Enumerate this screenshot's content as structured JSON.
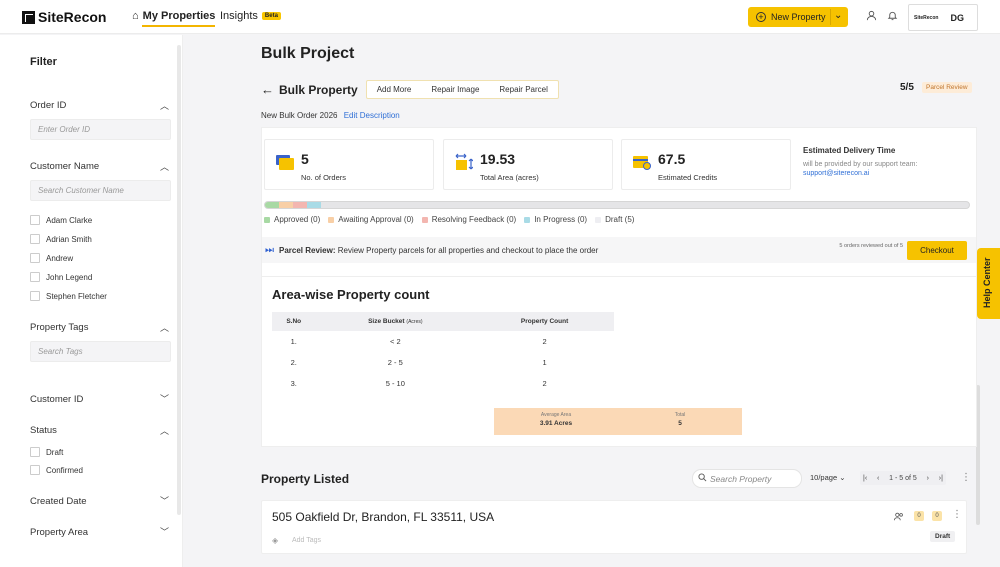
{
  "app": {
    "name": "SiteRecon"
  },
  "nav": {
    "home": "My Properties",
    "insights": "Insights",
    "beta": "Beta",
    "new_property": "New Property",
    "profile_logo": "SiteRecon",
    "initials": "DG"
  },
  "colors": {
    "accent": "#f6c200",
    "link": "#2f6fd6",
    "approved": "#a8d9a4",
    "awaiting": "#f8cfa6",
    "resolving": "#f3b6b0",
    "in_progress": "#a9dbe6",
    "draft": "#eeeef2"
  },
  "filter": {
    "title": "Filter",
    "order_id": {
      "label": "Order ID",
      "placeholder": "Enter Order ID"
    },
    "customer_name": {
      "label": "Customer Name",
      "placeholder": "Search Customer Name",
      "options": [
        "Adam Clarke",
        "Adrian Smith",
        "Andrew",
        "John Legend",
        "Stephen Fletcher"
      ]
    },
    "property_tags": {
      "label": "Property Tags",
      "placeholder": "Search Tags"
    },
    "customer_id": {
      "label": "Customer ID"
    },
    "status": {
      "label": "Status",
      "options": [
        "Draft",
        "Confirmed"
      ]
    },
    "created_date": {
      "label": "Created Date"
    },
    "property_area": {
      "label": "Property Area"
    }
  },
  "page": {
    "title": "Bulk Project",
    "subtitle": "Bulk Property",
    "tabs": [
      "Add More",
      "Repair Image",
      "Repair Parcel"
    ],
    "counter": "5/5",
    "stage_badge": "Parcel Review",
    "order_name": "New Bulk Order 2026",
    "edit_description": "Edit Description"
  },
  "stats": [
    {
      "value": "5",
      "caption": "No. of Orders",
      "icon": "folder-icon"
    },
    {
      "value": "19.53",
      "caption": "Total Area (acres)",
      "icon": "area-resize-icon"
    },
    {
      "value": "67.5",
      "caption": "Estimated Credits",
      "icon": "credits-icon"
    }
  ],
  "delivery": {
    "heading": "Estimated Delivery Time",
    "text": "will be provided by our support team:",
    "email": "support@siterecon.ai"
  },
  "statuses": [
    {
      "label": "Approved (0)",
      "count": 0
    },
    {
      "label": "Awaiting Approval (0)",
      "count": 0
    },
    {
      "label": "Resolving Feedback (0)",
      "count": 0
    },
    {
      "label": "In Progress (0)",
      "count": 0
    },
    {
      "label": "Draft (5)",
      "count": 5
    }
  ],
  "review": {
    "label": "Parcel Review:",
    "text": "Review Property parcels for all properties and checkout to place the order",
    "reviewed_note": "5 orders reviewed out of 5",
    "checkout": "Checkout"
  },
  "area_wise": {
    "title": "Area-wise Property count",
    "headers": {
      "sno": "S.No",
      "bucket": "Size Bucket",
      "bucket_unit": "(Acres)",
      "count": "Property Count"
    },
    "rows": [
      {
        "sno": "1.",
        "bucket": "< 2",
        "count": "2"
      },
      {
        "sno": "2.",
        "bucket": "2 - 5",
        "count": "1"
      },
      {
        "sno": "3.",
        "bucket": "5 - 10",
        "count": "2"
      }
    ],
    "average_area_label": "Average Area",
    "average_area_value": "3.91 Acres",
    "total_label": "Total",
    "total_value": "5"
  },
  "listing": {
    "title": "Property Listed",
    "search_placeholder": "Search Property",
    "per_page": "10/page",
    "page_range": "1 - 5 of 5",
    "property": {
      "address": "505 Oakfield Dr, Brandon, FL 33511, USA",
      "add_tags": "Add Tags",
      "count_a": "0",
      "count_b": "0",
      "status": "Draft"
    }
  },
  "help_center": "Help Center"
}
